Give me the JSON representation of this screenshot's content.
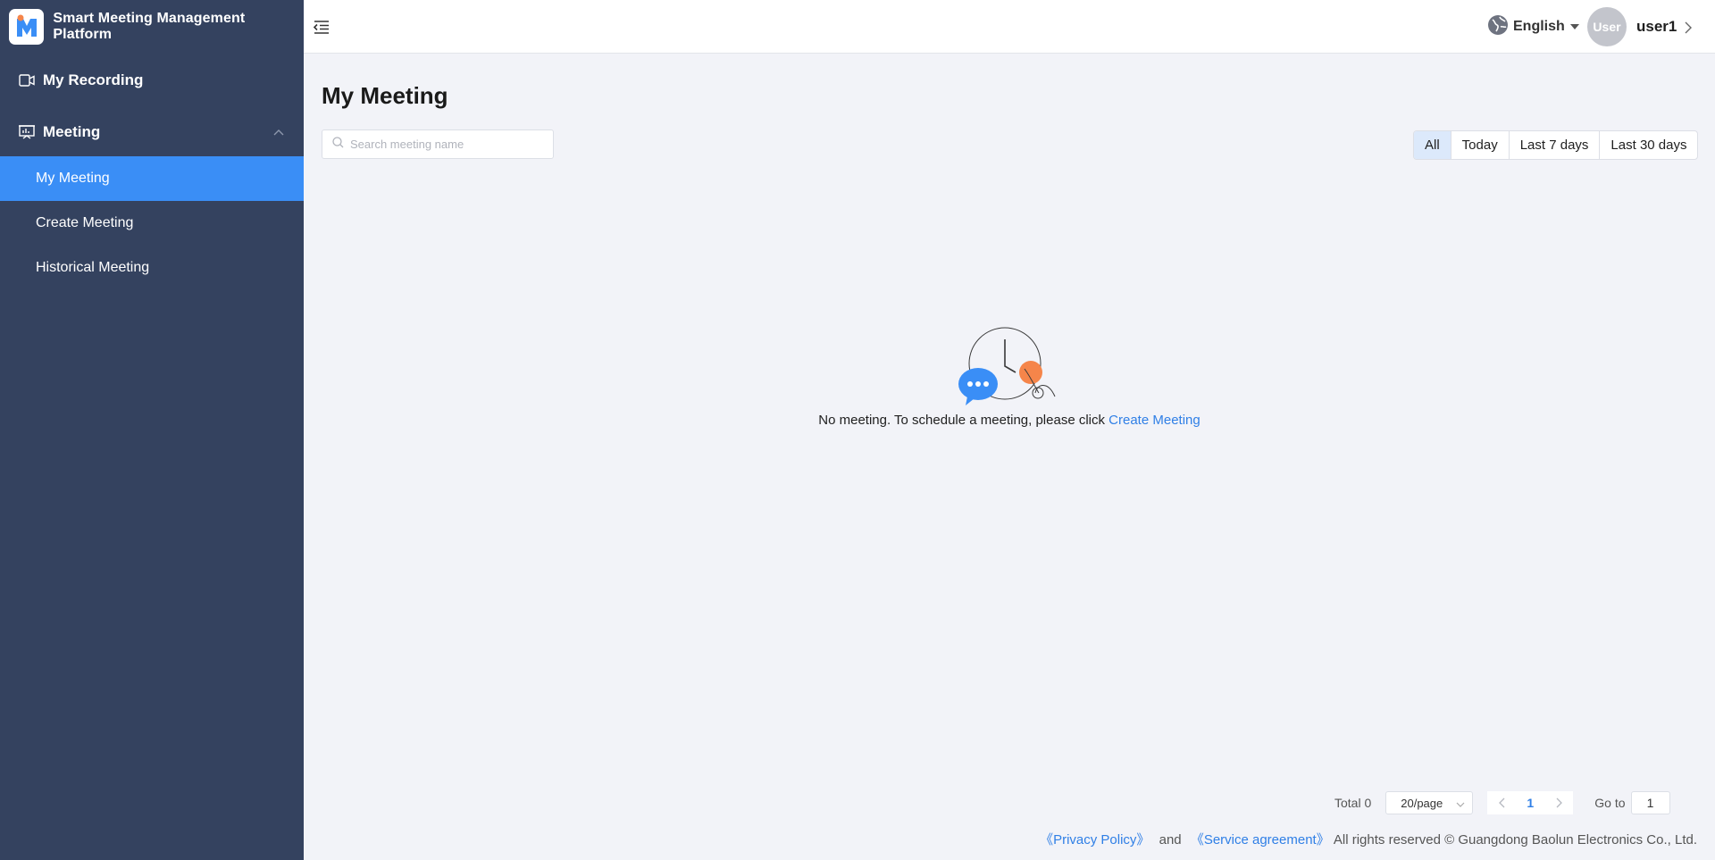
{
  "app": {
    "title": "Smart Meeting Management Platform"
  },
  "sidebar": {
    "items": [
      {
        "label": "My Recording",
        "icon": "recording-icon"
      },
      {
        "label": "Meeting",
        "icon": "presentation-icon",
        "expanded": true,
        "children": [
          {
            "label": "My Meeting",
            "active": true
          },
          {
            "label": "Create Meeting"
          },
          {
            "label": "Historical Meeting"
          }
        ]
      }
    ]
  },
  "header": {
    "language": "English",
    "avatar_text": "User",
    "username": "user1"
  },
  "main": {
    "title": "My Meeting",
    "search_placeholder": "Search meeting name",
    "filters": [
      "All",
      "Today",
      "Last 7 days",
      "Last 30 days"
    ],
    "active_filter": "All",
    "empty_text": "No meeting. To schedule a meeting, please click ",
    "empty_link": "Create Meeting"
  },
  "pagination": {
    "total": "Total 0",
    "page_size": "20/page",
    "current_page": "1",
    "goto_label": "Go to",
    "goto_value": "1"
  },
  "footer": {
    "privacy": "《Privacy Policy》",
    "and": "and",
    "service": "《Service agreement》",
    "rights": "All rights reserved © Guangdong Baolun Electronics Co., Ltd."
  },
  "colors": {
    "sidebar_bg": "#34425f",
    "accent": "#3a8ef6",
    "link": "#2f7fe6",
    "page_bg": "#f2f3f8",
    "illustration_orange": "#f5854a"
  }
}
